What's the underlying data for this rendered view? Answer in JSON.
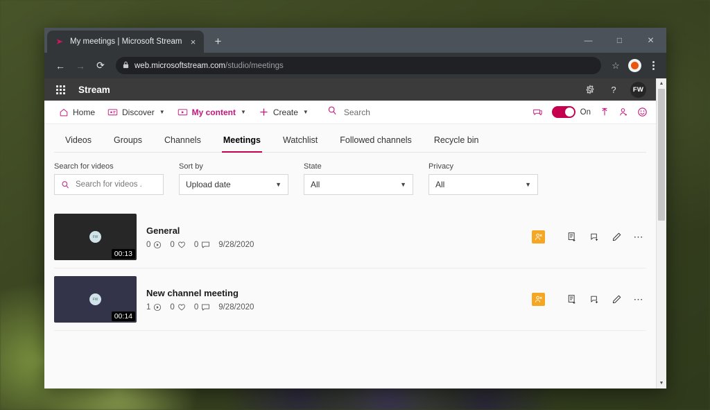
{
  "browser": {
    "tab": {
      "title": "My meetings | Microsoft Stream",
      "close": "×",
      "favicon": "stream-logo-icon"
    },
    "newtab_label": "+",
    "window_controls": {
      "minimize": "—",
      "maximize": "□",
      "close": "✕"
    },
    "nav": {
      "back": "←",
      "forward": "→",
      "reload": "⟳"
    },
    "address": {
      "lock": "🔒",
      "host": "web.microsoftstream.com",
      "path": "/studio/meetings"
    },
    "star": "☆",
    "menu_dots": "⋮"
  },
  "stream_header": {
    "waffle": "app-launcher-icon",
    "product": "Stream",
    "settings_icon": "⚙",
    "help_icon": "?",
    "avatar_initials": "FW"
  },
  "stream_nav": {
    "items": [
      {
        "label": "Home",
        "icon": "home-icon",
        "has_chevron": false,
        "active": false
      },
      {
        "label": "Discover",
        "icon": "discover-icon",
        "has_chevron": true,
        "active": false
      },
      {
        "label": "My content",
        "icon": "my-content-icon",
        "has_chevron": true,
        "active": true
      },
      {
        "label": "Create",
        "icon": "plus-icon",
        "has_chevron": true,
        "active": false
      }
    ],
    "search_placeholder": "Search",
    "toggle_label": "On",
    "toggle_on": true,
    "accent_color": "#c4177c",
    "toggle_color": "#c4004f"
  },
  "tabs": [
    {
      "label": "Videos",
      "active": false
    },
    {
      "label": "Groups",
      "active": false
    },
    {
      "label": "Channels",
      "active": false
    },
    {
      "label": "Meetings",
      "active": true
    },
    {
      "label": "Watchlist",
      "active": false
    },
    {
      "label": "Followed channels",
      "active": false
    },
    {
      "label": "Recycle bin",
      "active": false
    }
  ],
  "filters": {
    "search": {
      "label": "Search for videos",
      "placeholder": "Search for videos .",
      "value": ""
    },
    "sort_by": {
      "label": "Sort by",
      "value": "Upload date"
    },
    "state": {
      "label": "State",
      "value": "All"
    },
    "privacy": {
      "label": "Privacy",
      "value": "All"
    }
  },
  "videos": [
    {
      "title": "General",
      "duration": "00:13",
      "views": "0",
      "likes": "0",
      "comments": "0",
      "date": "9/28/2020",
      "thumb_color": "#272727",
      "privacy_badge": "restricted-icon"
    },
    {
      "title": "New channel meeting",
      "duration": "00:14",
      "views": "1",
      "likes": "0",
      "comments": "0",
      "date": "9/28/2020",
      "thumb_color": "#33334a",
      "privacy_badge": "restricted-icon"
    }
  ],
  "row_actions": {
    "add_to_group": "add-to-group-icon",
    "add_to_channel": "add-to-channel-icon",
    "edit": "edit-pencil-icon",
    "more": "⋯"
  }
}
